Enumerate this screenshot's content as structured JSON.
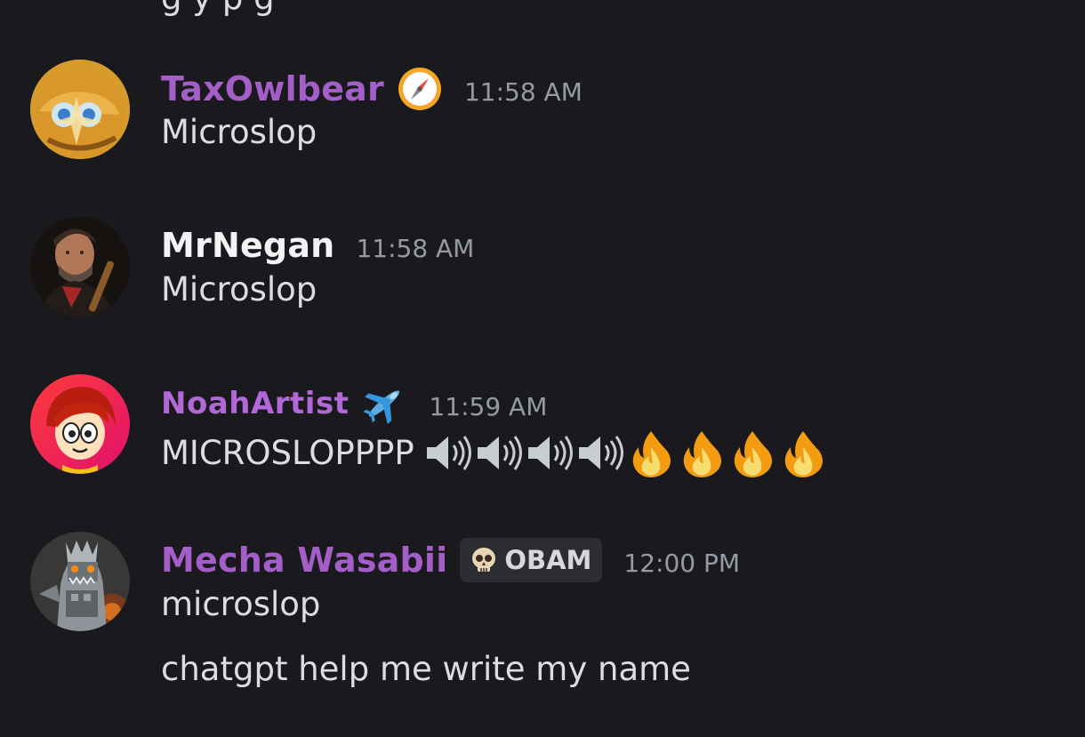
{
  "cutoff_text": "g         y  p      g",
  "messages": [
    {
      "username": "TaxOwlbear",
      "timestamp": "11:58 AM",
      "lines": [
        "Microslop"
      ],
      "badge": "compass-icon"
    },
    {
      "username": "MrNegan",
      "timestamp": "11:58 AM",
      "lines": [
        "Microslop"
      ]
    },
    {
      "username": "NoahArtist",
      "timestamp": "11:59 AM",
      "lines": [
        "MICROSLOPPPP"
      ],
      "badge": "airplane-icon",
      "emojis": [
        "speaker-icon",
        "speaker-icon",
        "speaker-icon",
        "speaker-icon",
        "fire-icon",
        "fire-icon",
        "fire-icon",
        "fire-icon"
      ]
    },
    {
      "username": "Mecha Wasabii",
      "timestamp": "12:00 PM",
      "tag": "OBAM",
      "tag_icon": "skull-icon",
      "lines": [
        "microslop",
        "chatgpt help me write my name"
      ]
    }
  ],
  "colors": {
    "background": "#1a1a1e",
    "username_purple": "#a45ec7",
    "username_white": "#f2f3f5",
    "message_text": "#dbdee1",
    "timestamp": "#949ba4"
  }
}
